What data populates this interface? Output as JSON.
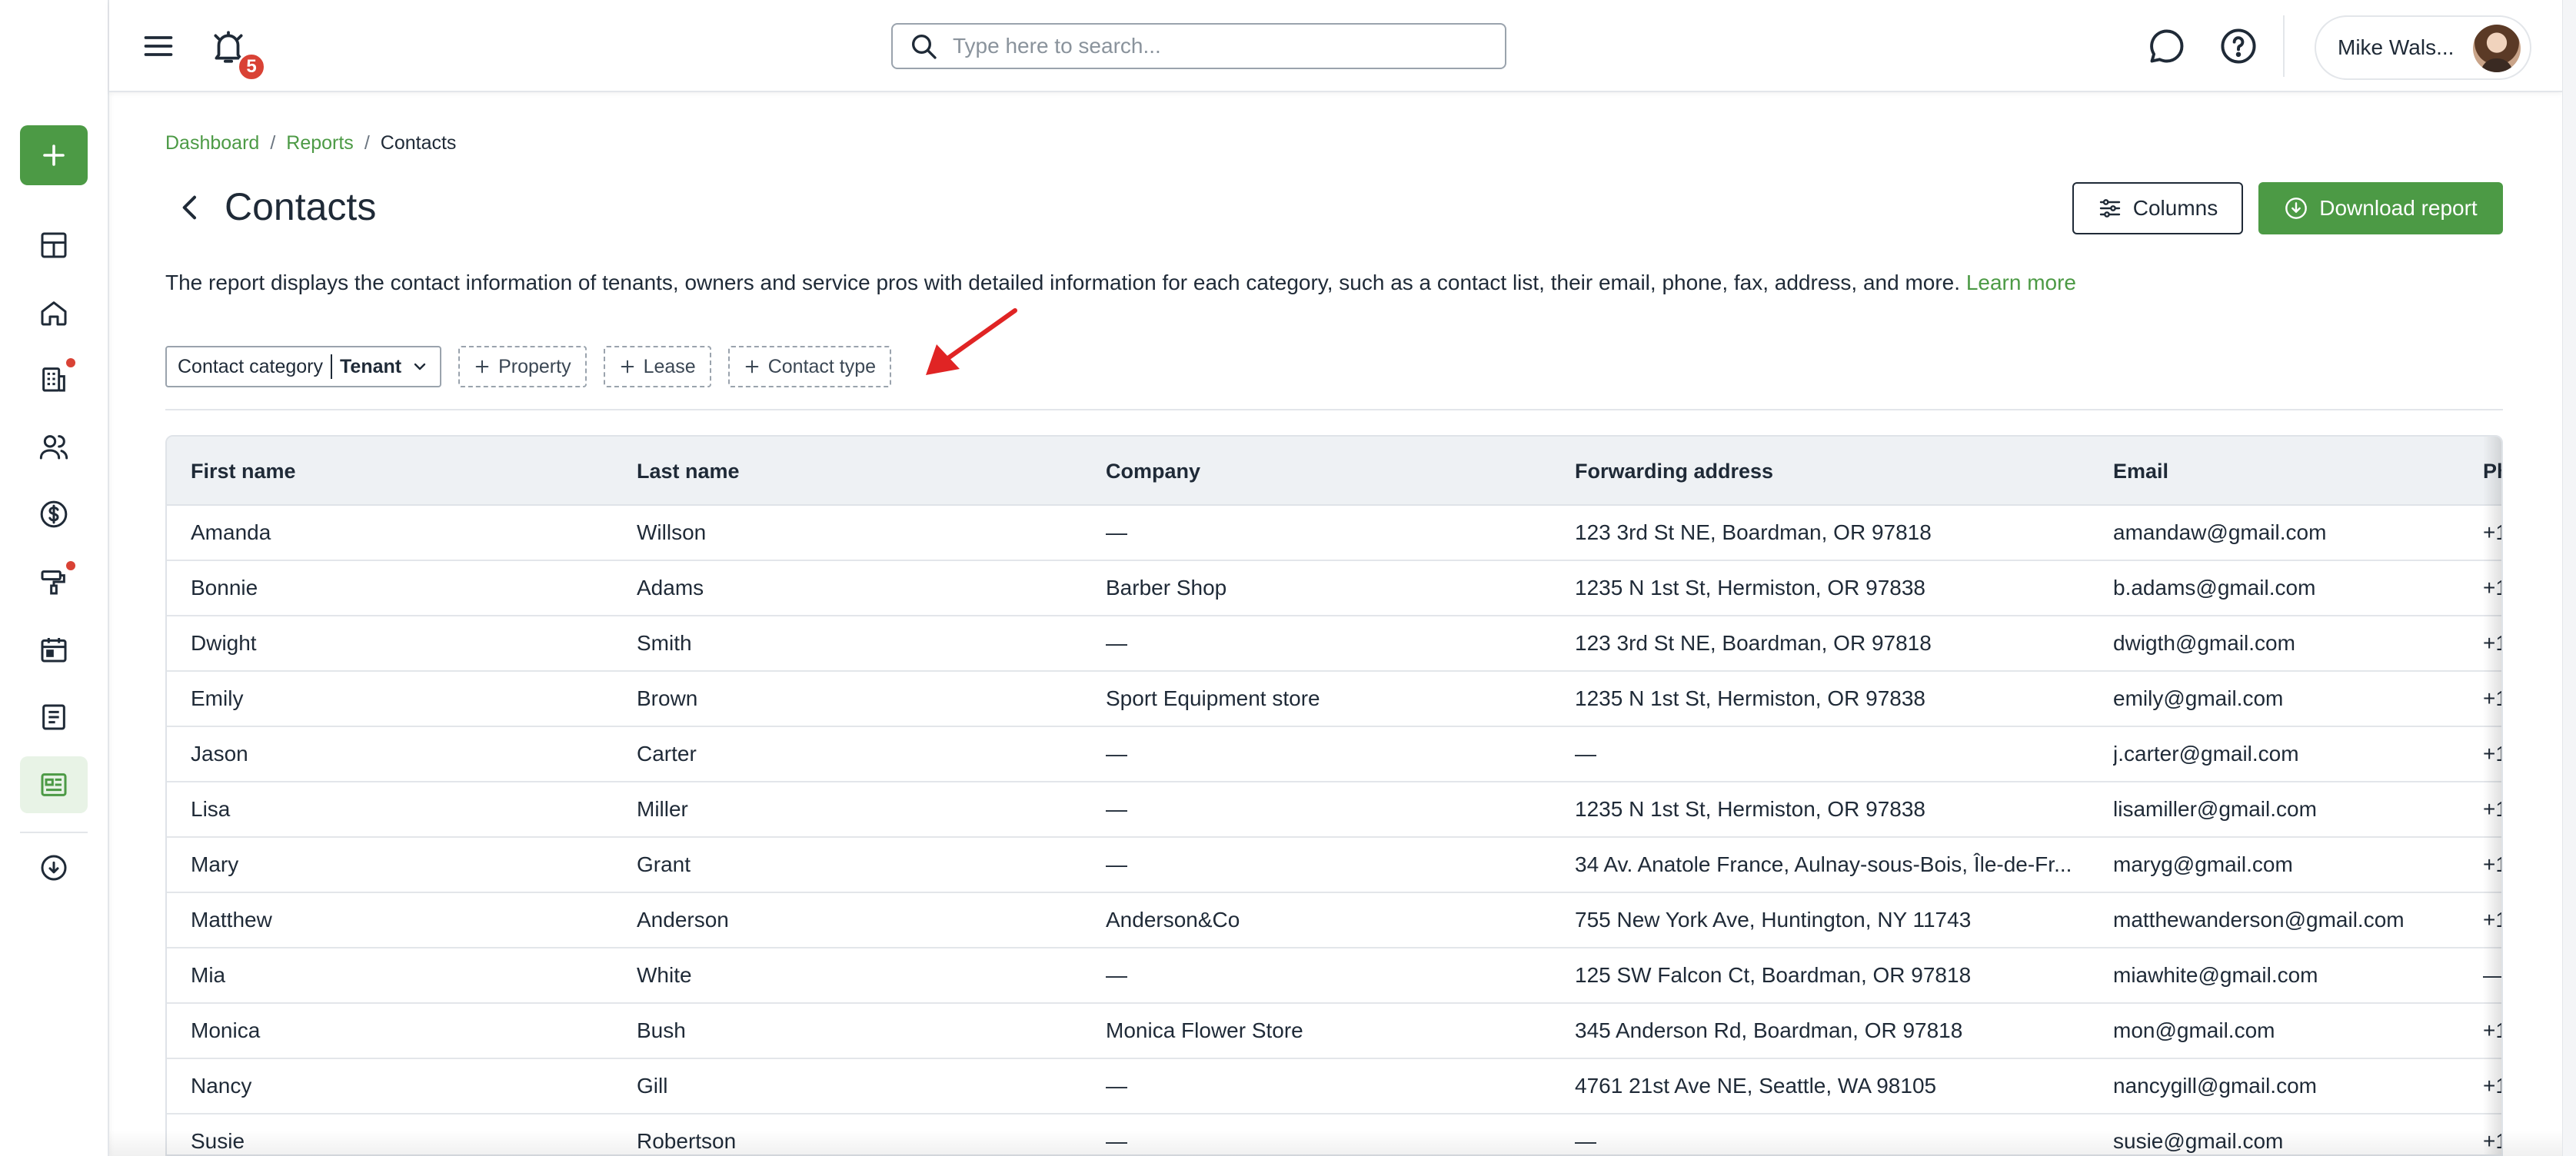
{
  "topbar": {
    "notification_count": "5",
    "search_placeholder": "Type here to search...",
    "user_name": "Mike Wals..."
  },
  "breadcrumb": {
    "items": [
      "Dashboard",
      "Reports"
    ],
    "current": "Contacts",
    "separator": "/"
  },
  "page": {
    "title": "Contacts",
    "description": "The report displays the contact information of tenants, owners and service pros with detailed information for each category, such as a contact list, their email, phone, fax, address, and more.",
    "learn_more": "Learn more"
  },
  "actions": {
    "columns_label": "Columns",
    "download_label": "Download report"
  },
  "filters": {
    "category_label": "Contact category",
    "category_value": "Tenant",
    "chips": [
      "Property",
      "Lease",
      "Contact type"
    ]
  },
  "table": {
    "columns": [
      "First name",
      "Last name",
      "Company",
      "Forwarding address",
      "Email",
      "Ph"
    ],
    "rows": [
      [
        "Amanda",
        "Willson",
        "—",
        "123 3rd St NE, Boardman, OR 97818",
        "amandaw@gmail.com",
        "+1"
      ],
      [
        "Bonnie",
        "Adams",
        "Barber Shop",
        "1235 N 1st St, Hermiston, OR 97838",
        "b.adams@gmail.com",
        "+1"
      ],
      [
        "Dwight",
        "Smith",
        "—",
        "123 3rd St NE, Boardman, OR 97818",
        "dwigth@gmail.com",
        "+1"
      ],
      [
        "Emily",
        "Brown",
        "Sport Equipment store",
        "1235 N 1st St, Hermiston, OR 97838",
        "emily@gmail.com",
        "+1"
      ],
      [
        "Jason",
        "Carter",
        "—",
        "—",
        "j.carter@gmail.com",
        "+1"
      ],
      [
        "Lisa",
        "Miller",
        "—",
        "1235 N 1st St, Hermiston, OR 97838",
        "lisamiller@gmail.com",
        "+1"
      ],
      [
        "Mary",
        "Grant",
        "—",
        "34 Av. Anatole France, Aulnay-sous-Bois, Île-de-Fr...",
        "maryg@gmail.com",
        "+1"
      ],
      [
        "Matthew",
        "Anderson",
        "Anderson&Co",
        "755 New York Ave, Huntington, NY 11743",
        "matthewanderson@gmail.com",
        "+1"
      ],
      [
        "Mia",
        "White",
        "—",
        "125 SW Falcon Ct, Boardman, OR 97818",
        "miawhite@gmail.com",
        "—"
      ],
      [
        "Monica",
        "Bush",
        "Monica Flower Store",
        "345 Anderson Rd, Boardman, OR 97818",
        "mon@gmail.com",
        "+1"
      ],
      [
        "Nancy",
        "Gill",
        "—",
        "4761 21st Ave NE, Seattle, WA 98105",
        "nancygill@gmail.com",
        "+1"
      ],
      [
        "Susie",
        "Robertson",
        "—",
        "—",
        "susie@gmail.com",
        "+1"
      ]
    ]
  },
  "sidebar": {
    "items": [
      "dashboard-icon",
      "home-icon",
      "building-icon",
      "people-icon",
      "dollar-icon",
      "maintenance-icon",
      "calendar-icon",
      "document-icon",
      "reports-icon",
      "download-cloud-icon"
    ]
  },
  "colors": {
    "accent": "#4c9a45",
    "badge": "#d94235",
    "text": "#1f2a37",
    "arrow": "#e02424"
  }
}
